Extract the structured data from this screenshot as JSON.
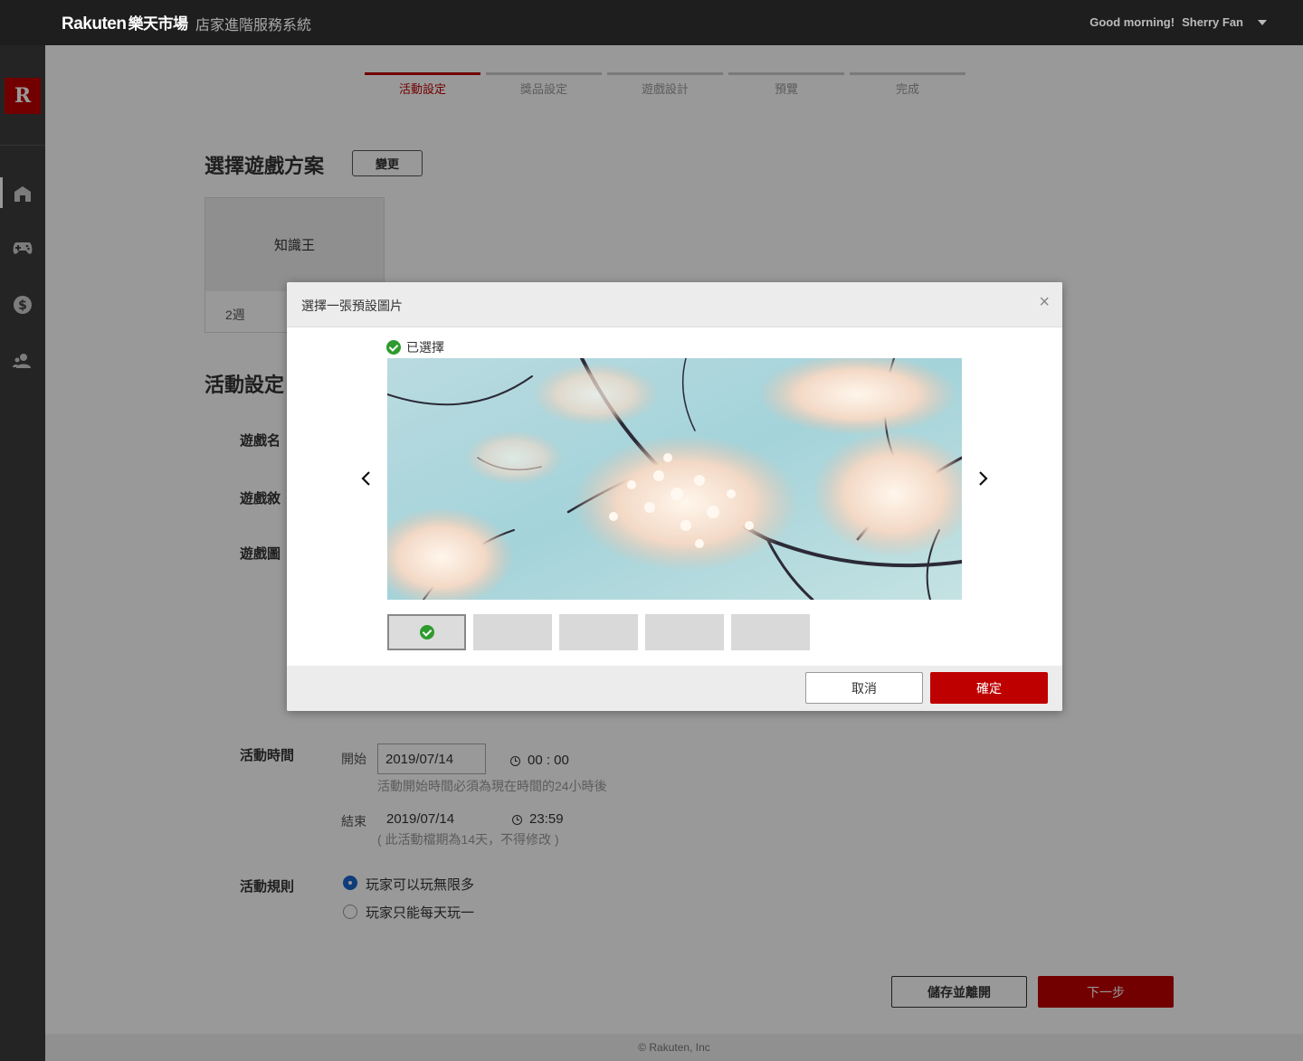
{
  "header": {
    "brand": "Rakuten",
    "brand_cn": "樂天市場",
    "system_title": "店家進階服務系統",
    "greeting": "Good morning!",
    "user_name": "Sherry Fan"
  },
  "sidebar": {
    "logo": "R",
    "items": [
      {
        "icon": "store-icon",
        "active": true
      },
      {
        "icon": "gamepad-icon",
        "active": false
      },
      {
        "icon": "dollar-icon",
        "active": false
      },
      {
        "icon": "users-icon",
        "active": false
      }
    ]
  },
  "steps": [
    {
      "label": "活動設定",
      "active": true
    },
    {
      "label": "獎品設定",
      "active": false
    },
    {
      "label": "遊戲設計",
      "active": false
    },
    {
      "label": "預覽",
      "active": false
    },
    {
      "label": "完成",
      "active": false
    }
  ],
  "plan": {
    "section_title": "選擇遊戲方案",
    "change_button": "變更",
    "card_title": "知識王",
    "card_duration": "2週"
  },
  "settings": {
    "section_title": "活動設定",
    "game_name_label": "遊戲名",
    "game_desc_label": "遊戲敘",
    "game_image_label": "遊戲圖",
    "time_label": "活動時間",
    "start_label": "開始",
    "start_date": "2019/07/14",
    "start_time": "00 : 00",
    "start_hint": "活動開始時間必須為現在時間的24小時後",
    "end_label": "結束",
    "end_date": "2019/07/14",
    "end_time": "23:59",
    "end_hint": "( 此活動檔期為14天，不得修改 )",
    "rules_label": "活動規則",
    "rule_option_1": "玩家可以玩無限多",
    "rule_option_2": "玩家只能每天玩一",
    "rule_selected": 1
  },
  "actions": {
    "save_label": "儲存並離開",
    "next_label": "下一步"
  },
  "footer": {
    "copyright": "© Rakuten, Inc"
  },
  "modal": {
    "title": "選擇一張預設圖片",
    "close": "×",
    "selected_tag": "已選擇",
    "cancel_label": "取消",
    "confirm_label": "確定",
    "thumbnail_count": 5,
    "selected_index": 0
  },
  "colors": {
    "brand_red": "#bf0000",
    "radio_blue": "#1a66cc",
    "check_green": "#2e9b2e"
  }
}
